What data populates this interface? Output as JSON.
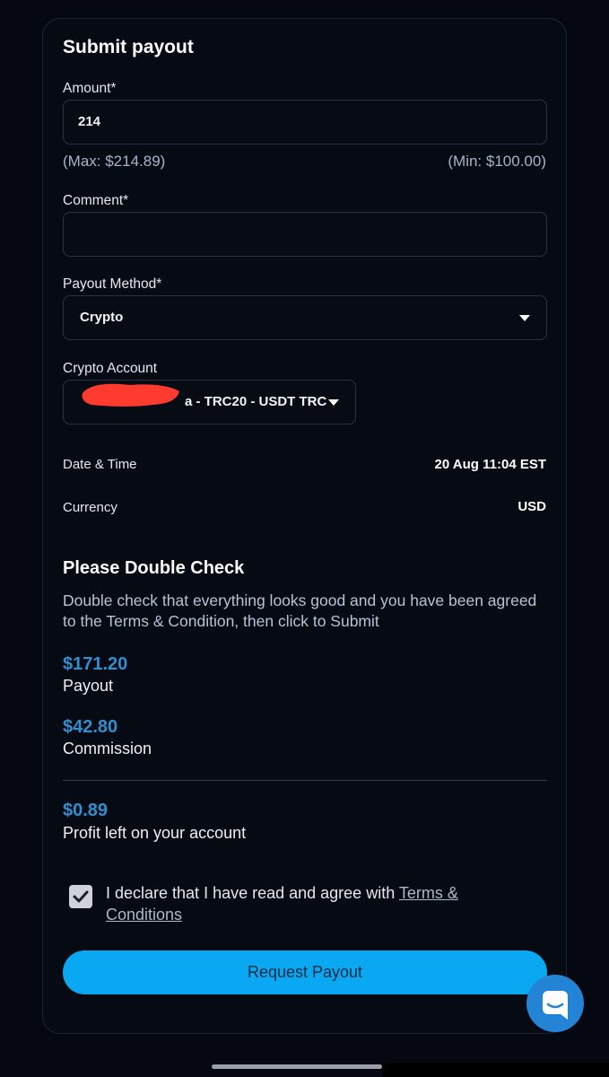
{
  "form": {
    "title": "Submit payout",
    "amount_label": "Amount*",
    "amount_value": "214",
    "max_hint": "(Max: $214.89)",
    "min_hint": "(Min: $100.00)",
    "comment_label": "Comment*",
    "comment_value": "",
    "method_label": "Payout Method*",
    "method_value": "Crypto",
    "account_label": "Crypto Account",
    "account_value": "a - TRC20 - USDT TRC"
  },
  "details": {
    "datetime_label": "Date & Time",
    "datetime_value": "20 Aug 11:04 EST",
    "currency_label": "Currency",
    "currency_value": "USD"
  },
  "check": {
    "title": "Please Double Check",
    "description": "Double check that everything looks good and you have been agreed to the Terms & Condition, then click to Submit",
    "payout_amount": "$171.20",
    "payout_label": "Payout",
    "commission_amount": "$42.80",
    "commission_label": "Commission",
    "profit_amount": "$0.89",
    "profit_label": "Profit left on your account"
  },
  "agreement": {
    "checked": true,
    "text": "I declare that I have read and agree with ",
    "link_text": "Terms & Conditions"
  },
  "actions": {
    "submit_label": "Request Payout"
  },
  "icons": {
    "chat": "chat-bubble-icon",
    "dropdown": "chevron-down-icon",
    "check": "checkmark-icon"
  },
  "colors": {
    "accent": "#0aa8f2",
    "amount": "#2f8fd0",
    "chat": "#2384d6"
  }
}
